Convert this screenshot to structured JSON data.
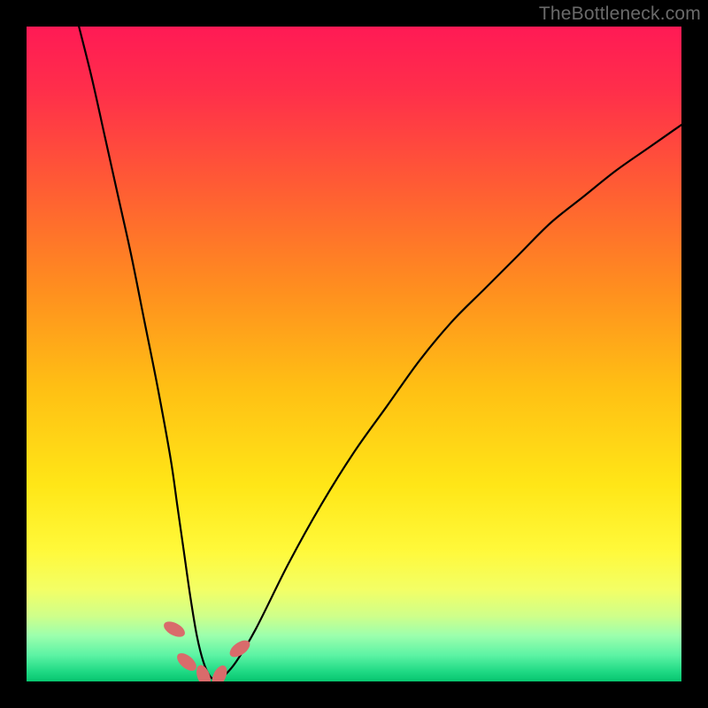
{
  "attribution": "TheBottleneck.com",
  "chart_data": {
    "type": "line",
    "title": "",
    "xlabel": "",
    "ylabel": "",
    "xlim": [
      0,
      100
    ],
    "ylim": [
      0,
      100
    ],
    "series": [
      {
        "name": "bottleneck-curve",
        "x": [
          8,
          10,
          12,
          14,
          16,
          18,
          20,
          22,
          23,
          24,
          25,
          26,
          27,
          28,
          29,
          30,
          32,
          35,
          40,
          45,
          50,
          55,
          60,
          65,
          70,
          75,
          80,
          85,
          90,
          95,
          100
        ],
        "values": [
          100,
          92,
          83,
          74,
          65,
          55,
          45,
          34,
          27,
          20,
          13,
          7,
          3,
          0.8,
          0.3,
          0.7,
          3,
          8,
          18,
          27,
          35,
          42,
          49,
          55,
          60,
          65,
          70,
          74,
          78,
          81.5,
          85
        ]
      }
    ],
    "annotations": [
      {
        "name": "bead-1",
        "x": 22.5,
        "y": 8
      },
      {
        "name": "bead-2",
        "x": 24.5,
        "y": 3
      },
      {
        "name": "bead-3",
        "x": 27.0,
        "y": 0.8
      },
      {
        "name": "bead-4",
        "x": 29.5,
        "y": 0.8
      },
      {
        "name": "bead-5",
        "x": 32.5,
        "y": 5
      }
    ],
    "gradient_stops": [
      {
        "offset": 0.0,
        "color": "#ff1a55"
      },
      {
        "offset": 0.1,
        "color": "#ff2f4a"
      },
      {
        "offset": 0.25,
        "color": "#ff5e33"
      },
      {
        "offset": 0.4,
        "color": "#ff8e1f"
      },
      {
        "offset": 0.55,
        "color": "#ffbf14"
      },
      {
        "offset": 0.7,
        "color": "#ffe617"
      },
      {
        "offset": 0.8,
        "color": "#fff93a"
      },
      {
        "offset": 0.86,
        "color": "#f3ff66"
      },
      {
        "offset": 0.9,
        "color": "#cfff8a"
      },
      {
        "offset": 0.93,
        "color": "#9cffad"
      },
      {
        "offset": 0.96,
        "color": "#5cf3a4"
      },
      {
        "offset": 0.985,
        "color": "#1fd984"
      },
      {
        "offset": 1.0,
        "color": "#07c56f"
      }
    ]
  }
}
